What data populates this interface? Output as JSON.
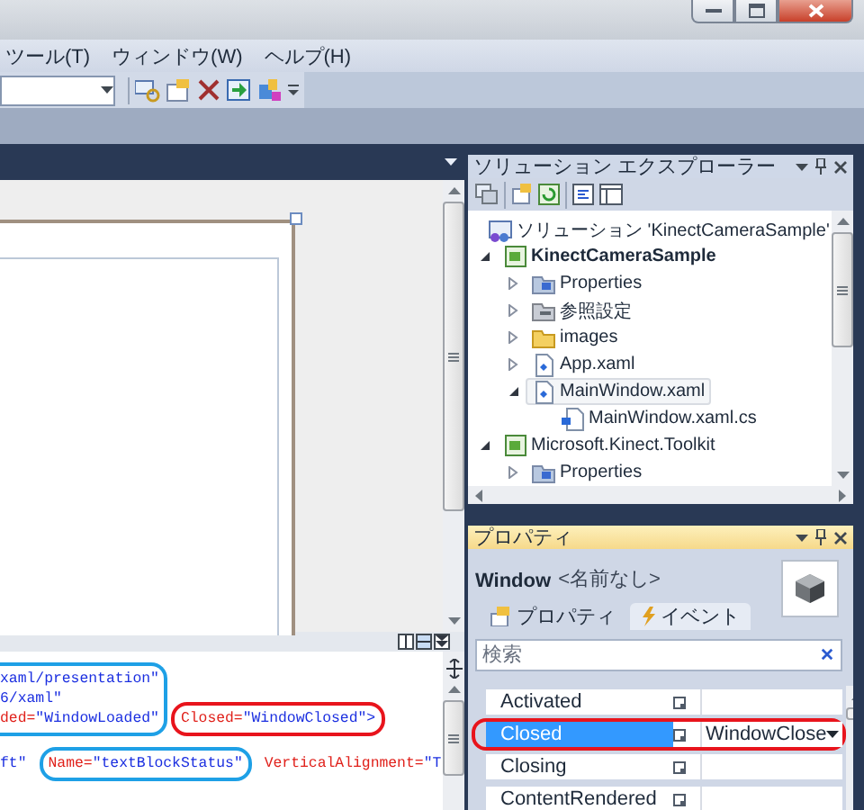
{
  "menu": [
    {
      "label": "ツール(T)"
    },
    {
      "label": "ウィンドウ(W)"
    },
    {
      "label": "ヘルプ(H)"
    }
  ],
  "solution_explorer": {
    "title": "ソリューション エクスプローラー",
    "tree": [
      {
        "label": "ソリューション 'KinectCameraSample'",
        "kind": "solution",
        "selected": false,
        "children": [
          {
            "label": "KinectCameraSample",
            "kind": "project",
            "startup": true,
            "selected": false,
            "expanded": true,
            "children": [
              {
                "label": "Properties",
                "kind": "properties",
                "selected": false,
                "expanded": false
              },
              {
                "label": "参照設定",
                "kind": "references",
                "selected": false,
                "expanded": false
              },
              {
                "label": "images",
                "kind": "folder",
                "selected": false,
                "expanded": false
              },
              {
                "label": "App.xaml",
                "kind": "xaml",
                "selected": false,
                "expanded": false
              },
              {
                "label": "MainWindow.xaml",
                "kind": "xaml",
                "selected": true,
                "expanded": true,
                "children": [
                  {
                    "label": "MainWindow.xaml.cs",
                    "kind": "cs",
                    "selected": false
                  }
                ]
              }
            ]
          },
          {
            "label": "Microsoft.Kinect.Toolkit",
            "kind": "project",
            "startup": false,
            "selected": false,
            "expanded": true,
            "children": [
              {
                "label": "Properties",
                "kind": "properties",
                "selected": false,
                "expanded": false
              }
            ]
          }
        ]
      }
    ]
  },
  "properties": {
    "title": "プロパティ",
    "object_type": "Window",
    "object_name": "<名前なし>",
    "tabs": [
      {
        "label": "プロパティ",
        "kind": "properties",
        "selected": false
      },
      {
        "label": "イベント",
        "kind": "events",
        "selected": true
      }
    ],
    "search": {
      "placeholder": "検索"
    },
    "rows": [
      {
        "name": "Activated",
        "selected": false
      },
      {
        "name": "Closed",
        "value": "WindowClose",
        "selected": true,
        "color": "#e8141c"
      },
      {
        "name": "Closing",
        "selected": false
      },
      {
        "name": "ContentRendered",
        "selected": false
      }
    ]
  },
  "xaml_editor": {
    "rows": [
      {
        "segments": [
          {
            "color": "#1ea0e6",
            "lines": [
              [
                {
                  "kind": "value",
                  "text": "xaml/presentation\""
                }
              ],
              [
                {
                  "kind": "value",
                  "text": "6/xaml\""
                }
              ],
              [
                {
                  "kind": "attr",
                  "text": "ded="
                },
                {
                  "kind": "value",
                  "text": "\"WindowLoaded\""
                }
              ]
            ]
          },
          {
            "color": "#e8141c",
            "lines": [
              [
                {
                  "kind": "attr",
                  "text": "Closed="
                },
                {
                  "kind": "value",
                  "text": "\"WindowClosed\">"
                }
              ]
            ]
          }
        ]
      },
      {
        "segments": [
          {
            "lines": [
              [
                {
                  "kind": "value",
                  "text": "ft\""
                }
              ]
            ]
          },
          {
            "color": "#1ea0e6",
            "lines": [
              [
                {
                  "kind": "attr",
                  "text": "Name="
                },
                {
                  "kind": "value",
                  "text": "\"textBlockStatus\""
                }
              ]
            ]
          },
          {
            "lines": [
              [
                {
                  "kind": "attr",
                  "text": "VerticalAlignment="
                },
                {
                  "kind": "value",
                  "text": "\"T"
                }
              ]
            ]
          }
        ]
      }
    ]
  }
}
